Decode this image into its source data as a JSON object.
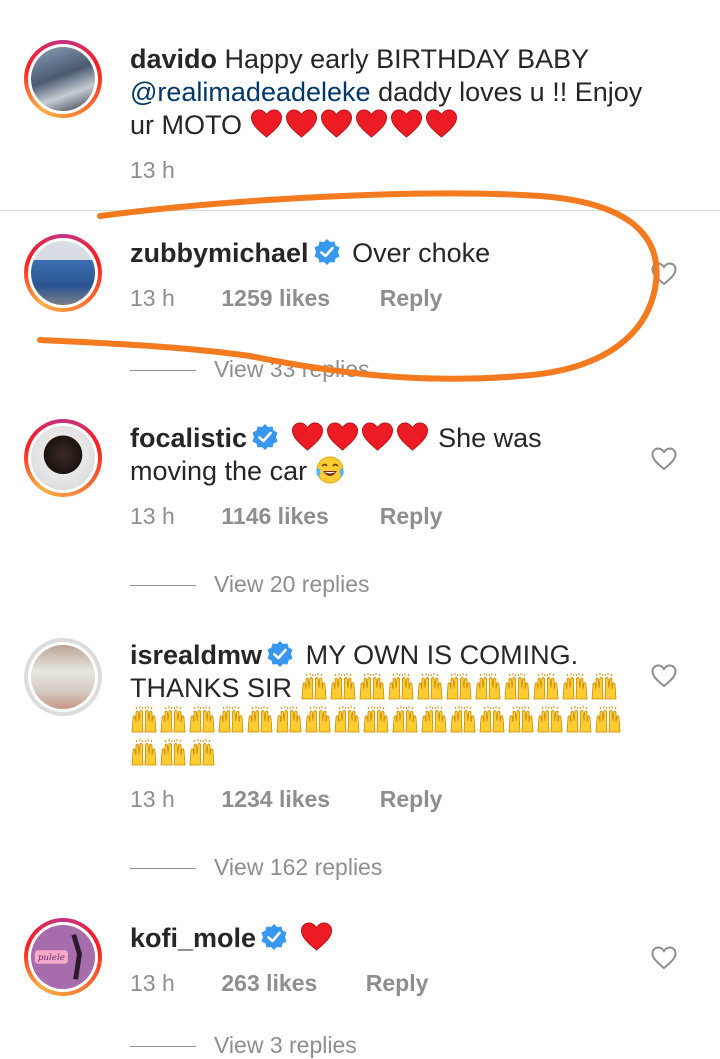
{
  "comments": [
    {
      "username": "davido",
      "text_a": "Happy early BIRTHDAY BABY",
      "mention": "@realimadeadeleke",
      "text_b": "daddy loves u !! Enjoy ur MOTO",
      "hearts": 6,
      "time": "13 h"
    },
    {
      "username": "zubbymichael",
      "verified": true,
      "text": "Over choke",
      "time": "13 h",
      "likes": "1259 likes",
      "reply": "Reply",
      "view_replies": "View 33 replies"
    },
    {
      "username": "focalistic",
      "verified": true,
      "hearts": 4,
      "text_a": "She was",
      "text_b": "moving the car",
      "emoji": "face-with-tears-of-joy",
      "time": "13 h",
      "likes": "1146 likes",
      "reply": "Reply",
      "view_replies": "View 20 replies"
    },
    {
      "username": "isrealdmw",
      "verified": true,
      "text_a": "MY OWN IS COMING.",
      "text_b": "THANKS SIR",
      "emoji": "raising-hands",
      "raising_hands_count": 31,
      "time": "13 h",
      "likes": "1234 likes",
      "reply": "Reply",
      "view_replies": "View 162 replies"
    },
    {
      "username": "kofi_mole",
      "verified": true,
      "hearts": 1,
      "time": "13 h",
      "likes": "263 likes",
      "reply": "Reply",
      "view_replies": "View 3 replies"
    }
  ],
  "colors": {
    "text": "#262626",
    "secondary": "#8e8e8e",
    "mention": "#00376b",
    "verified": "#3897f0",
    "heart": "#ed1c24",
    "annotation": "#f47a20"
  }
}
